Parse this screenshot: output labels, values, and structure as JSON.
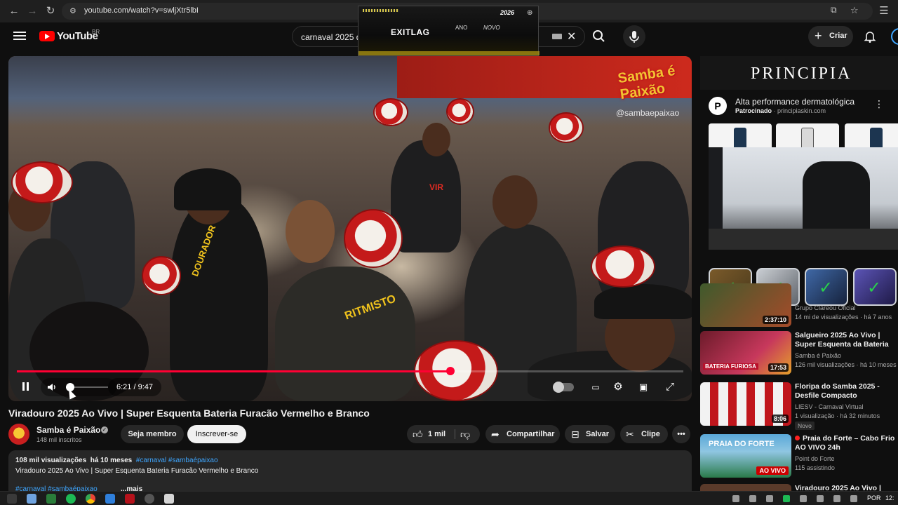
{
  "browser": {
    "url": "youtube.com/watch?v=swljXtr5lbI"
  },
  "header": {
    "logo_text": "YouTube",
    "country_code": "BR",
    "search_query": "carnaval 2025 d",
    "create_label": "Criar"
  },
  "top_ad": {
    "brand": "EXITLAG",
    "word_ano": "ANO",
    "word_novo": "NOVO",
    "year_badge": "2026"
  },
  "player": {
    "watermark_logo": "Samba é Paixão",
    "watermark_handle": "@sambaepaixao",
    "shirt_text_1": "RITMISTO",
    "shirt_text_2": "DOURADOR",
    "drum_text": "VIR",
    "time_display": "6:21 / 9:47",
    "progress_fraction": 0.65,
    "volume_fraction": 0.1
  },
  "video": {
    "title": "Viradouro 2025 Ao Vivo | Super Esquenta Bateria Furacão Vermelho e Branco",
    "channel_name": "Samba é Paixão",
    "subscribers": "148 mil inscritos",
    "join_label": "Seja membro",
    "subscribe_label": "Inscrever-se",
    "likes": "1 mil",
    "share_label": "Compartilhar",
    "save_label": "Salvar",
    "clip_label": "Clipe"
  },
  "description": {
    "views": "108 mil visualizações",
    "age": "há 10 meses",
    "tags_top": "#carnaval #sambaépaixao",
    "body": "Viradouro 2025 Ao Vivo | Super Esquenta Bateria Furacão Vermelho e Branco",
    "tags_bottom": "#carnaval #sambaépaixao",
    "more_label": "...mais"
  },
  "side_ad": {
    "banner_word": "PRINCIPIA",
    "title": "Alta performance dermatológica",
    "sponsored_label": "Patrocinado",
    "domain": "principiaskin.com"
  },
  "recommendations": [
    {
      "title": "",
      "channel": "Grupo Clareou Oficial",
      "stats": "14 mi de visualizações · há 7 anos",
      "duration": "2:37:10",
      "thumb_text": "",
      "badge": ""
    },
    {
      "title": "Salgueiro 2025 Ao Vivo | Super Esquenta da Bateria Furiosa | ...",
      "channel": "Samba é Paixão",
      "stats": "126 mil visualizações · há 10 meses",
      "duration": "17:53",
      "thumb_text": "BATERIA FURIOSA",
      "badge": ""
    },
    {
      "title": "Floripa do Samba 2025 - Desfile Compacto",
      "channel": "LIESV - Carnaval Virtual",
      "stats": "1 visualização · há 32 minutos",
      "duration": "8:06",
      "thumb_text": "",
      "badge": "Novo"
    },
    {
      "title": "Praia do Forte – Cabo Frio AO VIVO 24h",
      "channel": "Point do Forte",
      "stats": "115 assistindo",
      "duration": "",
      "thumb_text": "PRAIA DO FORTE",
      "badge": "",
      "live_label": "AO VIVO"
    },
    {
      "title": "Viradouro 2025 Ao Vivo |",
      "channel": "",
      "stats": "",
      "duration": "",
      "thumb_text": "",
      "badge": ""
    }
  ],
  "taskbar": {
    "language": "POR",
    "clock": "12:"
  },
  "colors": {
    "youtube_red": "#ff0000",
    "progress_red": "#ff0033",
    "link_blue": "#3ea6ff",
    "check_green": "#29d04c"
  }
}
